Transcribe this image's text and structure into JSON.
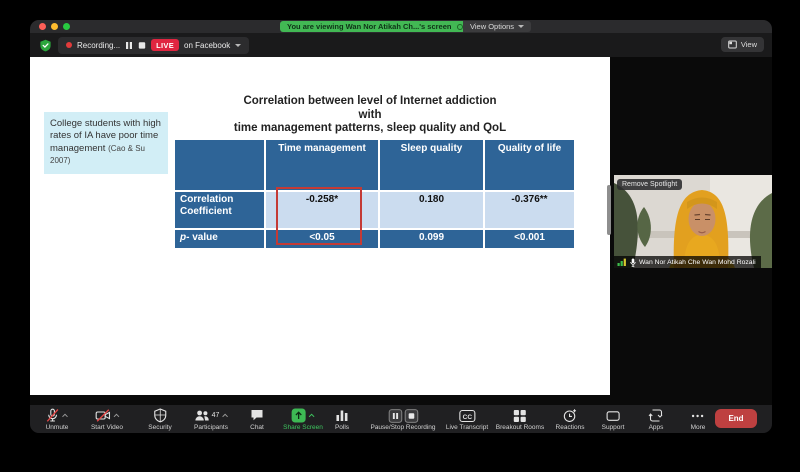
{
  "titlebar": {
    "banner": "You are viewing Wan Nor Atikah Ch...'s screen",
    "view_options_label": "View Options"
  },
  "controlbar": {
    "recording_label": "Recording...",
    "live_label": "LIVE",
    "facebook_label": "on Facebook",
    "view_label": "View"
  },
  "slide": {
    "title_lines": {
      "l1": "Correlation between level of Internet addiction",
      "l2": "with",
      "l3": "time management patterns, sleep quality and QoL"
    },
    "note_text": "College students with high rates of IA have poor time management ",
    "note_citation": "(Cao & Su 2007)",
    "table": {
      "columns": [
        "Time management",
        "Sleep quality",
        "Quality of life"
      ],
      "rows": [
        {
          "label": "Correlation Coefficient",
          "values": [
            "-0.258*",
            "0.180",
            "-0.376**"
          ]
        },
        {
          "label": "p- value",
          "label_italic": "p",
          "label_rest": "- value",
          "values": [
            "<0.05",
            "0.099",
            "<0.001"
          ]
        }
      ]
    }
  },
  "participant": {
    "spotlight_label": "Remove Spotlight",
    "name": "Wan Nor Atikah Che Wan Mohd Rozali"
  },
  "toolbar": {
    "participants_count": "47",
    "items": [
      {
        "label": "Unmute"
      },
      {
        "label": "Start Video"
      },
      {
        "label": "Security"
      },
      {
        "label": "Participants"
      },
      {
        "label": "Chat"
      },
      {
        "label": "Share Screen"
      },
      {
        "label": "Polls"
      },
      {
        "label": "Pause/Stop Recording"
      },
      {
        "label": "Live Transcript"
      },
      {
        "label": "Breakout Rooms"
      },
      {
        "label": "Reactions"
      },
      {
        "label": "Support"
      },
      {
        "label": "Apps"
      },
      {
        "label": "More"
      }
    ],
    "end_label": "End"
  },
  "colors": {
    "banner_green": "#42B854",
    "live_red": "#E02540",
    "table_blue": "#2E6497",
    "table_light": "#CBDCEF",
    "highlight_red": "#C43A35",
    "share_green": "#3DB954",
    "end_red": "#BE4040",
    "note_cyan": "#D2EEF6"
  }
}
